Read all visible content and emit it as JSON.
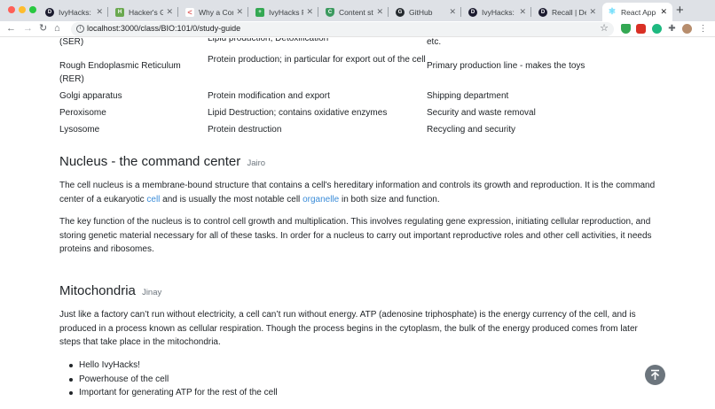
{
  "browser": {
    "tabs": [
      {
        "title": "IvyHacks: Fir",
        "favicon": "D",
        "color": "#1a1a2e"
      },
      {
        "title": "Hacker's Guid",
        "favicon": "H",
        "color": "#6aa84f"
      },
      {
        "title": "Why a Compu",
        "favicon": "<",
        "color": "#e06666"
      },
      {
        "title": "IvyHacks Reci",
        "favicon": "+",
        "color": "#34a853"
      },
      {
        "title": "Content style",
        "favicon": "C",
        "color": "#3c9a5f"
      },
      {
        "title": "GitHub",
        "favicon": "G",
        "color": "#24292e"
      },
      {
        "title": "IvyHacks: Fir",
        "favicon": "D",
        "color": "#1a1a2e"
      },
      {
        "title": "Recall | Deve",
        "favicon": "D",
        "color": "#1a1a2e"
      },
      {
        "title": "React App",
        "favicon": "R",
        "color": "#61dafb"
      }
    ],
    "new_tab": "+",
    "url": "localhost:3000/class/BIO:101/0/study-guide"
  },
  "organelle_table": [
    [
      "(SER)",
      "Lipid production; Detoxification",
      "etc."
    ],
    [
      "Rough Endoplasmic Reticulum (RER)",
      "Protein production; in particular for export out of the cell",
      "Primary production line - makes the toys"
    ],
    [
      "Golgi apparatus",
      "Protein modification and export",
      "Shipping department"
    ],
    [
      "Peroxisome",
      "Lipid Destruction; contains oxidative enzymes",
      "Security and waste removal"
    ],
    [
      "Lysosome",
      "Protein destruction",
      "Recycling and security"
    ]
  ],
  "nucleus": {
    "title": "Nucleus - the command center",
    "author": "Jairo",
    "p1_before": "The cell nucleus is a membrane-bound structure that contains a cell's hereditary information and controls its growth and reproduction. It is the command center of a eukaryotic ",
    "p1_link1": "cell",
    "p1_middle": " and is usually the most notable cell ",
    "p1_link2": "organelle",
    "p1_after": " in both size and function.",
    "p2": "The key function of the nucleus is to control cell growth and multiplication. This involves regulating gene expression, initiating cellular reproduction, and storing genetic material necessary for all of these tasks. In order for a nucleus to carry out important reproductive roles and other cell activities, it needs proteins and ribosomes."
  },
  "mitochondria": {
    "title": "Mitochondria",
    "author": "Jinay",
    "p1": "Just like a factory can’t run without electricity, a cell can’t run without energy. ATP (adenosine triphosphate) is the energy currency of the cell, and is produced in a process known as cellular respiration. Though the process begins in the cytoplasm, the bulk of the energy produced comes from later steps that take place in the mitochondria.",
    "bullets": [
      "Hello IvyHacks!",
      "Powerhouse of the cell",
      "Important for generating ATP for the rest of the cell"
    ]
  }
}
